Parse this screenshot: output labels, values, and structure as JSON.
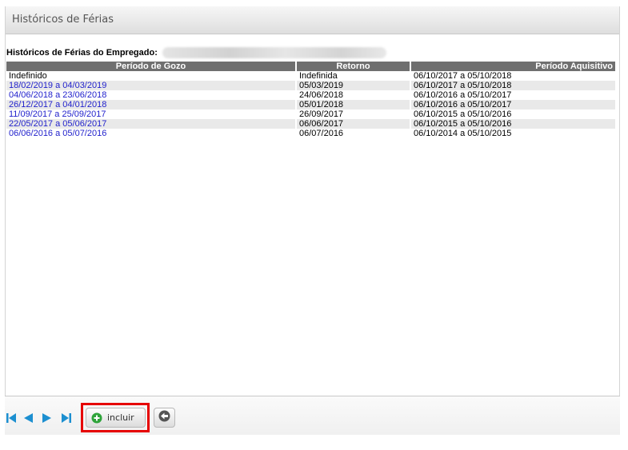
{
  "panel": {
    "title": "Históricos de Férias"
  },
  "employee": {
    "label": "Históricos de Férias do Empregado:",
    "name": "████ ███████ ██████ █ ██████ ████ ██████"
  },
  "table": {
    "headers": [
      "Período de Gozo",
      "Retorno",
      "Período Aquisitivo"
    ],
    "rows": [
      {
        "gozo": "Indefinido",
        "retorno": "Indefinida",
        "aquisitivo": "06/10/2017 a 05/10/2018"
      },
      {
        "gozo": "18/02/2019 a 04/03/2019",
        "retorno": "05/03/2019",
        "aquisitivo": "06/10/2017 a 05/10/2018"
      },
      {
        "gozo": "04/06/2018 a 23/06/2018",
        "retorno": "24/06/2018",
        "aquisitivo": "06/10/2016 a 05/10/2017"
      },
      {
        "gozo": "26/12/2017 a 04/01/2018",
        "retorno": "05/01/2018",
        "aquisitivo": "06/10/2016 a 05/10/2017"
      },
      {
        "gozo": "11/09/2017 a 25/09/2017",
        "retorno": "26/09/2017",
        "aquisitivo": "06/10/2015 a 05/10/2016"
      },
      {
        "gozo": "22/05/2017 a 05/06/2017",
        "retorno": "06/06/2017",
        "aquisitivo": "06/10/2015 a 05/10/2016"
      },
      {
        "gozo": "06/06/2016 a 05/07/2016",
        "retorno": "06/07/2016",
        "aquisitivo": "06/10/2014 a 05/10/2015"
      }
    ]
  },
  "footer": {
    "incluir_label": "incluir",
    "icons": [
      "first-page-icon",
      "previous-page-icon",
      "next-page-icon",
      "last-page-icon",
      "plus-circle-icon",
      "back-arrow-icon"
    ]
  },
  "colors": {
    "header_bg": "#6f6f6f",
    "link": "#2222cc",
    "highlight": "#e60000",
    "nav_blue": "#1c8fd0",
    "plus_green": "#2ea33a"
  }
}
